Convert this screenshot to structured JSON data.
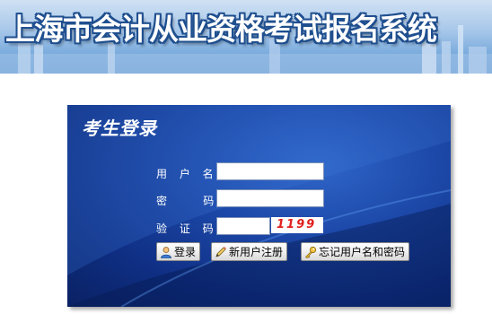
{
  "banner": {
    "title": "上海市会计从业资格考试报名系统"
  },
  "login": {
    "title": "考生登录",
    "username_label": "用 户 名：",
    "password_label": "密    码：",
    "captcha_label": "验 证 码：",
    "username_value": "",
    "password_value": "",
    "captcha_value": "",
    "captcha_code": "1199",
    "login_button": "登录",
    "register_button": "新用户注册",
    "forgot_button": "忘记用户名和密码"
  },
  "icons": {
    "login": "user-icon",
    "register": "pencil-icon",
    "forgot": "key-icon"
  },
  "colors": {
    "panel": "#1c48a8",
    "captcha_text": "#e0201c",
    "banner_title_outline": "#1f4f8f"
  }
}
